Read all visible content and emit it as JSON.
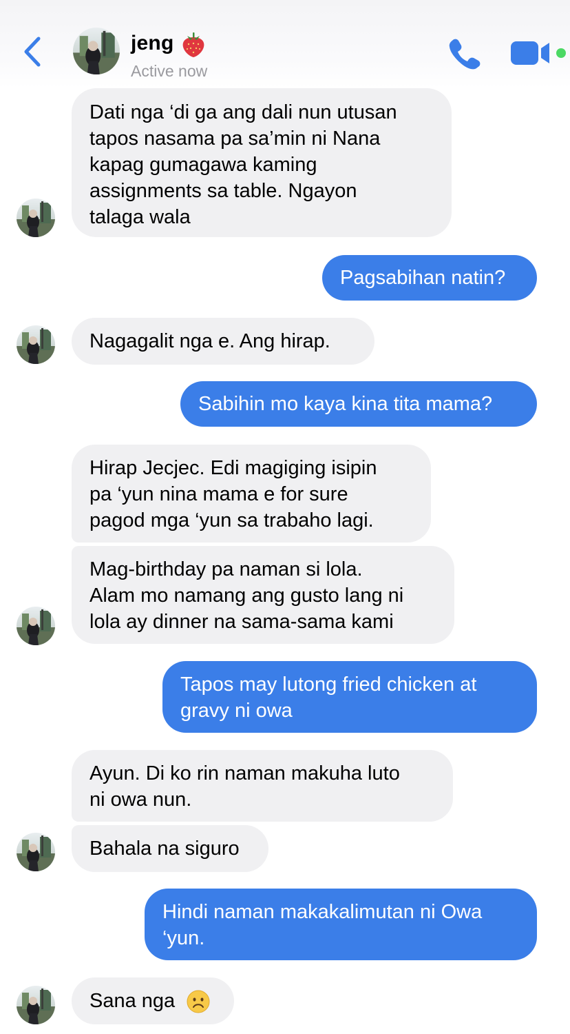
{
  "header": {
    "contact_name": "jeng",
    "name_emoji": "strawberry-icon",
    "status": "Active now",
    "back_icon": "chevron-left-icon",
    "call_icon": "phone-icon",
    "video_icon": "video-camera-icon",
    "accent_color": "#3b7ee8",
    "active_color": "#4cd964"
  },
  "messages": [
    {
      "from": "contact",
      "lines": [
        "Dati nga ‘di ga ang dali nun utusan",
        "tapos nasama pa sa’min ni Nana",
        "kapag gumagawa kaming",
        "assignments sa table. Ngayon",
        "talaga wala"
      ]
    },
    {
      "from": "me",
      "lines": [
        "Pagsabihan natin?"
      ]
    },
    {
      "from": "contact",
      "lines": [
        "Nagagalit nga e. Ang hirap."
      ]
    },
    {
      "from": "me",
      "lines": [
        "Sabihin mo kaya kina tita mama?"
      ]
    },
    {
      "from": "contact",
      "lines": [
        "Hirap Jecjec. Edi magiging isipin",
        "pa ‘yun nina mama e for sure",
        "pagod mga ‘yun sa trabaho lagi."
      ]
    },
    {
      "from": "contact",
      "lines": [
        "Mag-birthday pa naman si lola.",
        "Alam mo namang ang gusto lang ni",
        "lola ay dinner na sama-sama kami"
      ]
    },
    {
      "from": "me",
      "lines": [
        "Tapos may lutong fried chicken at",
        "gravy ni owa"
      ]
    },
    {
      "from": "contact",
      "lines": [
        "Ayun. Di ko rin naman makuha luto",
        "ni owa nun."
      ]
    },
    {
      "from": "contact",
      "lines": [
        "Bahala na siguro"
      ]
    },
    {
      "from": "me",
      "lines": [
        "Hindi naman makakalimutan ni Owa",
        "‘yun."
      ]
    },
    {
      "from": "contact",
      "lines": [
        "Sana nga"
      ],
      "emoji": "frowning-face-icon"
    }
  ]
}
